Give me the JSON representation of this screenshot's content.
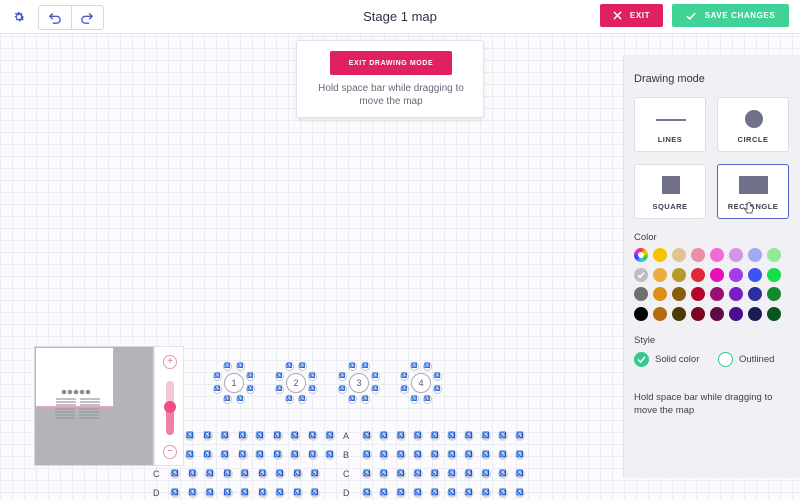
{
  "header": {
    "title": "Stage 1 map",
    "exit_label": "EXIT",
    "save_label": "SAVE CHANGES"
  },
  "popup": {
    "button_label": "EXIT DRAWING MODE",
    "hint": "Hold space bar while dragging to move the map"
  },
  "panel": {
    "title": "Drawing mode",
    "tools": [
      {
        "label": "LINES",
        "icon": "line-icon"
      },
      {
        "label": "CIRCLE",
        "icon": "circle-icon"
      },
      {
        "label": "SQUARE",
        "icon": "square-icon"
      },
      {
        "label": "RECTANGLE",
        "icon": "rectangle-icon",
        "selected": true
      }
    ],
    "color_label": "Color",
    "colors": [
      "rainbow",
      "#f4c400",
      "#e0c592",
      "#ea8fa5",
      "#f26bd6",
      "#d493e6",
      "#a3aaf2",
      "#8fea99",
      "#bdbdc5",
      "#e9ad3d",
      "#b79a2b",
      "#e3263a",
      "#e510b9",
      "#a63be8",
      "#3d53ef",
      "#12e04a",
      "#6f6f70",
      "#de8f16",
      "#855f0c",
      "#b3052d",
      "#991070",
      "#7a1fc6",
      "#2b2fa0",
      "#128a2d",
      "#050505",
      "#b06d12",
      "#4b3b05",
      "#7a0624",
      "#5c0b44",
      "#4b0d8c",
      "#1a1a55",
      "#0a5420"
    ],
    "selected_color": "#bdbdc5",
    "style_label": "Style",
    "style_options": [
      {
        "label": "Solid color",
        "selected": true
      },
      {
        "label": "Outlined",
        "selected": false
      }
    ],
    "hint": "Hold space bar while dragging to move the map"
  },
  "map": {
    "tables": [
      "1",
      "2",
      "3",
      "4"
    ],
    "rows_left": [
      "C",
      "D"
    ],
    "rows_right": [
      "A",
      "B",
      "C",
      "D"
    ],
    "seat_glyph": "♿"
  }
}
